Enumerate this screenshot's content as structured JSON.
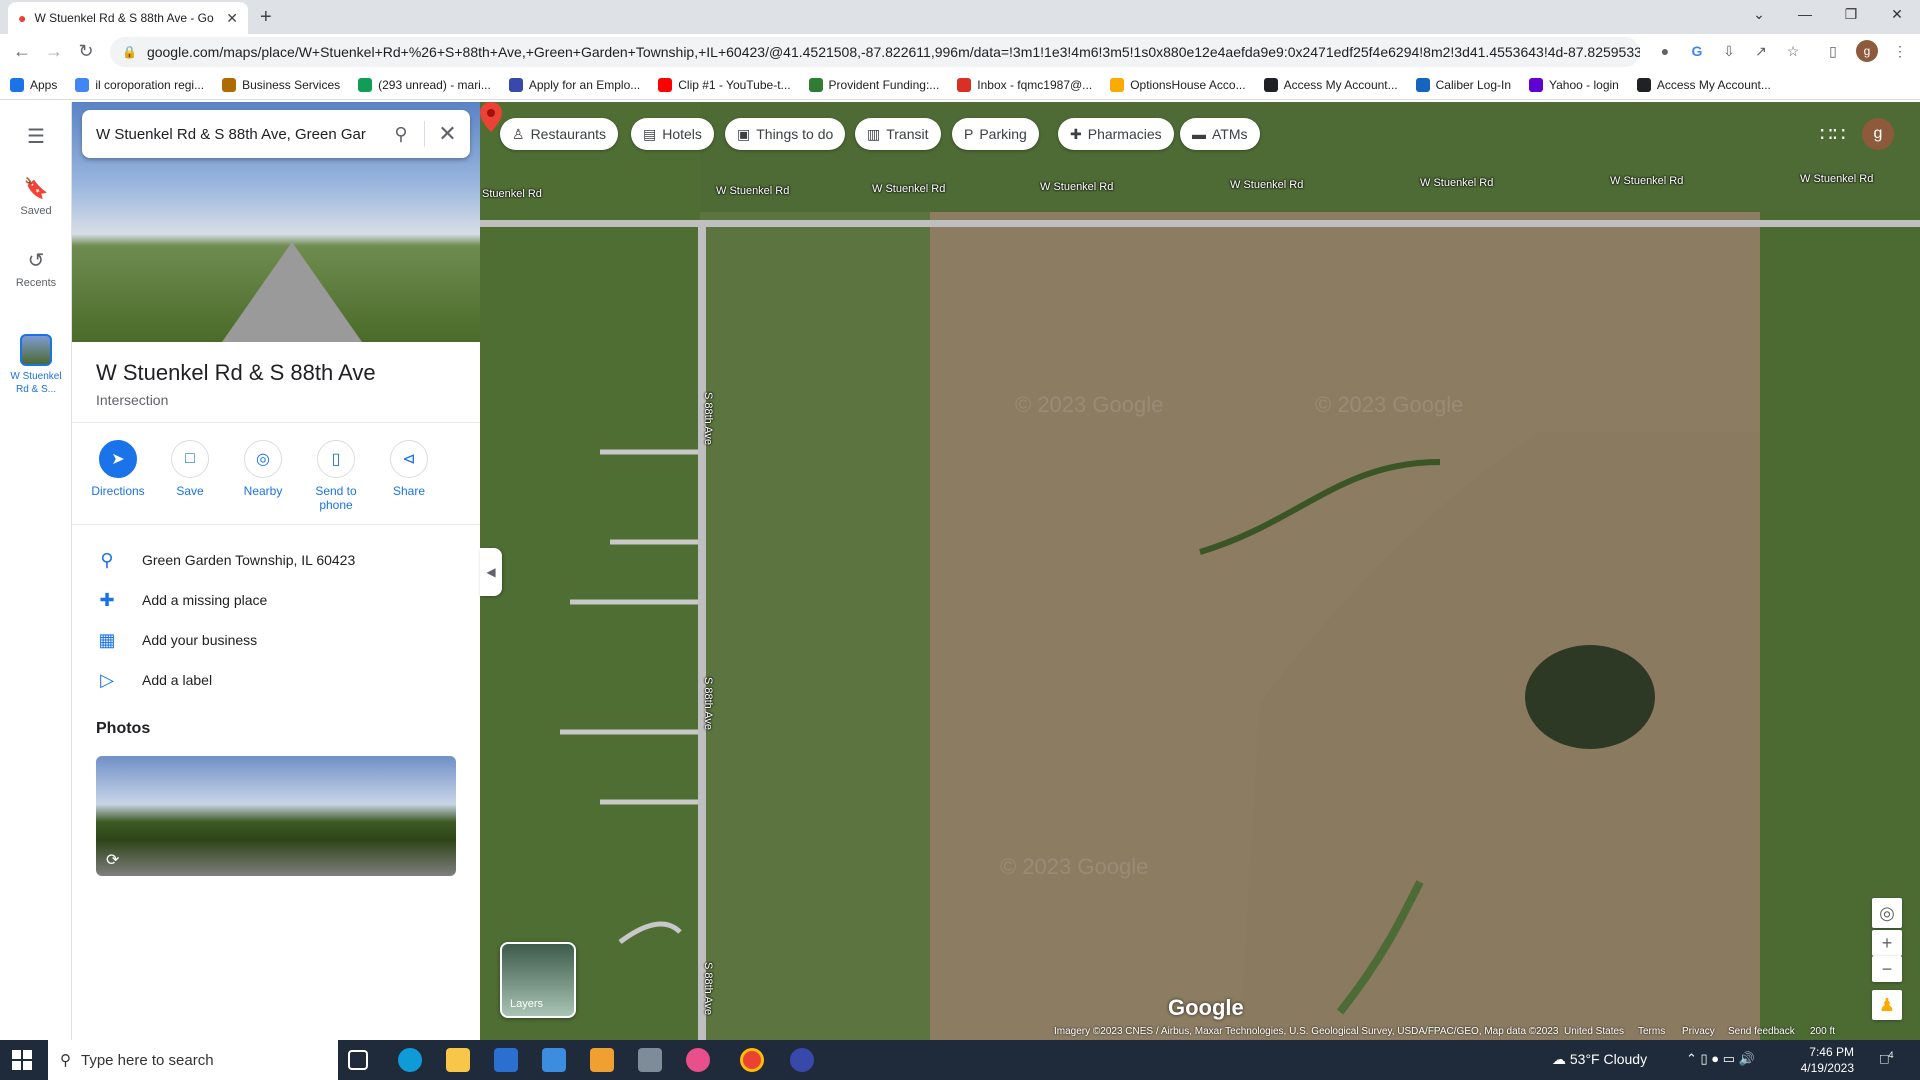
{
  "browser": {
    "tab_title": "W Stuenkel Rd & S 88th Ave - Go",
    "url": "google.com/maps/place/W+Stuenkel+Rd+%26+S+88th+Ave,+Green+Garden+Township,+IL+60423/@41.4521508,-87.822611,996m/data=!3m1!1e3!4m6!3m5!1s0x880e12e4aefda9e9:0x2471edf25f4e6294!8m2!3d41.4553643!4d-87.8259533!1...",
    "profile_initial": "g"
  },
  "bookmarks": [
    {
      "label": "Apps",
      "color": "#1a73e8"
    },
    {
      "label": "il coroporation regi...",
      "color": "#4285f4"
    },
    {
      "label": "Business Services",
      "color": "#b06a00"
    },
    {
      "label": "(293 unread) - mari...",
      "color": "#0f9d58"
    },
    {
      "label": "Apply for an Emplo...",
      "color": "#3949ab"
    },
    {
      "label": "Clip #1 - YouTube-t...",
      "color": "#ff0000"
    },
    {
      "label": "Provident Funding:...",
      "color": "#2e7d32"
    },
    {
      "label": "Inbox - fqmc1987@...",
      "color": "#d93025"
    },
    {
      "label": "OptionsHouse Acco...",
      "color": "#f9ab00"
    },
    {
      "label": "Access My Account...",
      "color": "#202124"
    },
    {
      "label": "Caliber Log-In",
      "color": "#1565c0"
    },
    {
      "label": "Yahoo - login",
      "color": "#6001d2"
    },
    {
      "label": "Access My Account...",
      "color": "#202124"
    }
  ],
  "rail": {
    "saved": "Saved",
    "recents": "Recents",
    "current": "W Stuenkel Rd & S..."
  },
  "panel": {
    "search_value": "W Stuenkel Rd & S 88th Ave, Green Gar",
    "title": "W Stuenkel Rd & S 88th Ave",
    "type": "Intersection",
    "actions": [
      "Directions",
      "Save",
      "Nearby",
      "Send to phone",
      "Share"
    ],
    "info": [
      {
        "text": "Green Garden Township, IL 60423",
        "icon": "pin-icon"
      },
      {
        "text": "Add a missing place",
        "icon": "add-place-icon"
      },
      {
        "text": "Add your business",
        "icon": "business-icon"
      },
      {
        "text": "Add a label",
        "icon": "label-icon"
      }
    ],
    "photos_heading": "Photos"
  },
  "map": {
    "chips": [
      "Restaurants",
      "Hotels",
      "Things to do",
      "Transit",
      "Parking",
      "Pharmacies",
      "ATMs"
    ],
    "road_h": "W Stuenkel Rd",
    "road_v": "S 88th Ave",
    "road_h_partial": "Stuenkel Rd",
    "layers_label": "Layers",
    "logo": "Google",
    "watermark": "© 2023 Google",
    "attribution": "Imagery ©2023 CNES / Airbus, Maxar Technologies, U.S. Geological Survey, USDA/FPAC/GEO, Map data ©2023",
    "country": "United States",
    "terms": "Terms",
    "privacy": "Privacy",
    "feedback": "Send feedback",
    "scale": "200 ft",
    "avatar_initial": "g"
  },
  "taskbar": {
    "search_placeholder": "Type here to search",
    "weather": "53°F  Cloudy",
    "time": "7:46 PM",
    "date": "4/19/2023",
    "notif_count": "4"
  }
}
